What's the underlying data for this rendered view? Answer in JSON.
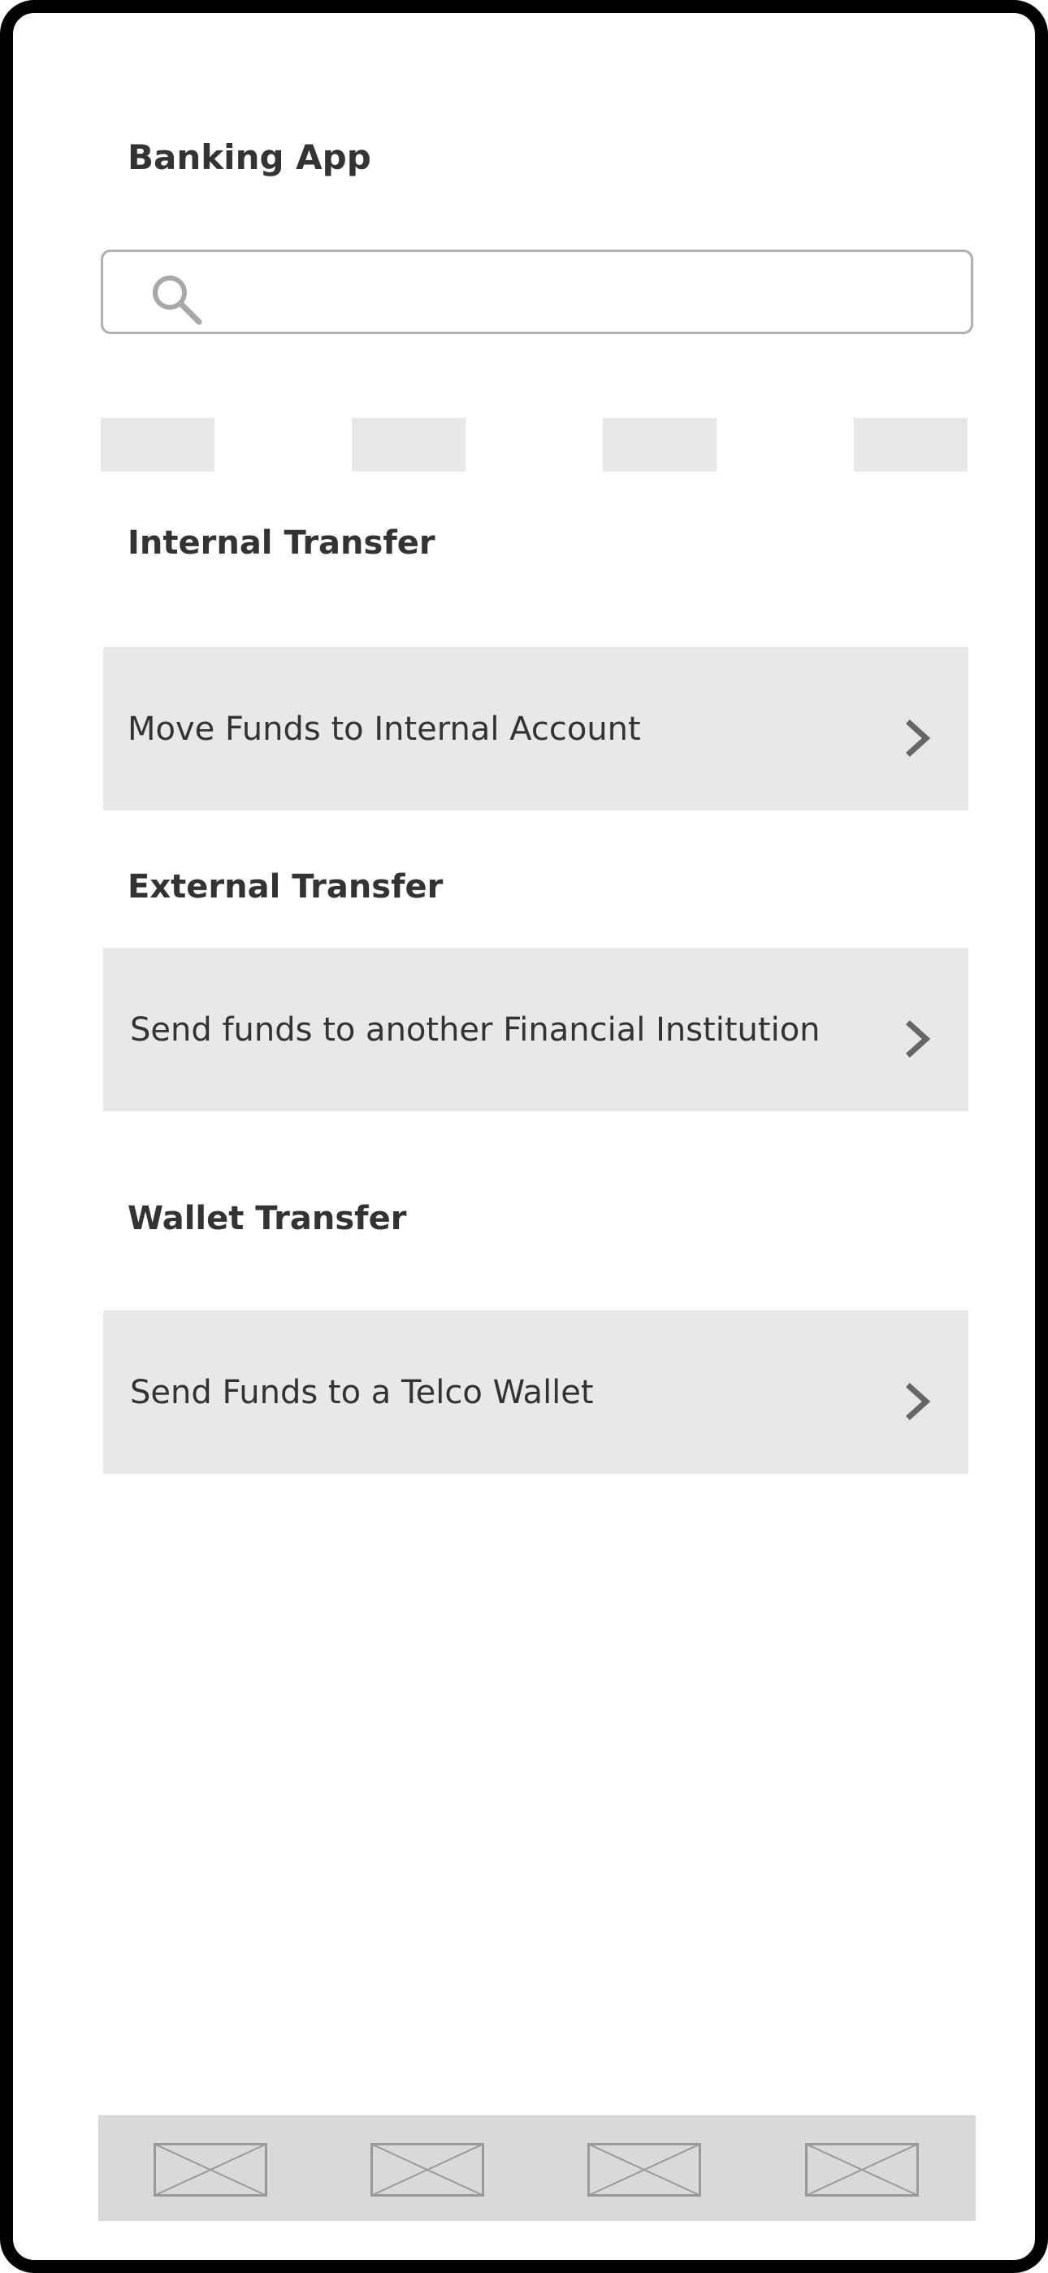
{
  "app": {
    "title": "Banking App"
  },
  "search": {
    "placeholder": "",
    "value": ""
  },
  "quick_tabs": [
    "",
    "",
    "",
    ""
  ],
  "sections": [
    {
      "heading": "Internal Transfer",
      "item_label": "Move Funds to Internal Account"
    },
    {
      "heading": "External Transfer",
      "item_label": "Send funds to another Financial Institution"
    },
    {
      "heading": "Wallet Transfer",
      "item_label": "Send Funds to a Telco Wallet"
    }
  ],
  "bottom_nav": {
    "item_count": 4,
    "icon": "image-placeholder-icon"
  },
  "colors": {
    "frame": "#000000",
    "text": "#333333",
    "card_background": "#e8e8e8",
    "nav_background": "#d9d9d9",
    "chevron": "#666666",
    "placeholder_stroke": "#999999"
  }
}
